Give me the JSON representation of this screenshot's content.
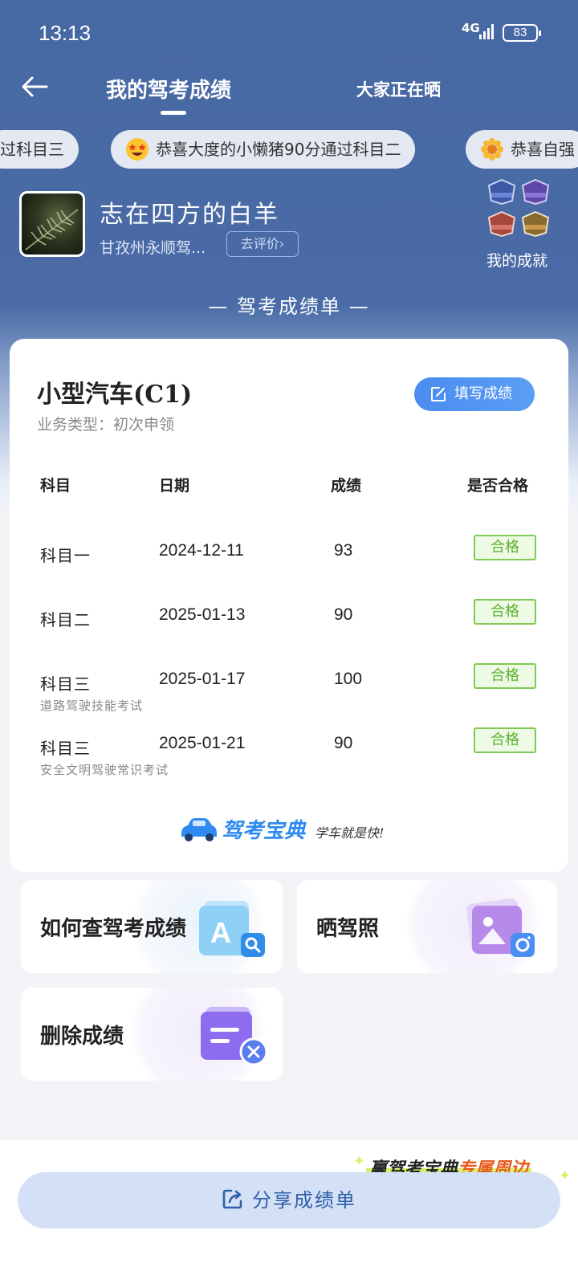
{
  "status": {
    "time": "13:13",
    "network": "4G",
    "battery": "83"
  },
  "nav": {
    "active_tab": "我的驾考成绩",
    "other_tab": "大家正在晒"
  },
  "ticker": [
    "过科目三",
    "恭喜大度的小懒猪90分通过科目二",
    "恭喜自强"
  ],
  "profile": {
    "name": "志在四方的白羊",
    "school": "甘孜州永顺驾...",
    "rate_button": "去评价",
    "achievement_label": "我的成就"
  },
  "section_title": "— 驾考成绩单 —",
  "card": {
    "car_type": "小型汽车(C1)",
    "business_type": "业务类型：初次申领",
    "fill_button": "填写成绩",
    "headers": {
      "subject": "科目",
      "date": "日期",
      "score": "成绩",
      "passed": "是否合格"
    },
    "rows": [
      {
        "subject": "科目一",
        "sub": "",
        "date": "2024-12-11",
        "score": "93",
        "status": "合格"
      },
      {
        "subject": "科目二",
        "sub": "",
        "date": "2025-01-13",
        "score": "90",
        "status": "合格"
      },
      {
        "subject": "科目三",
        "sub": "道路驾驶技能考试",
        "date": "2025-01-17",
        "score": "100",
        "status": "合格"
      },
      {
        "subject": "科目三",
        "sub": "安全文明驾驶常识考试",
        "date": "2025-01-21",
        "score": "90",
        "status": "合格"
      }
    ],
    "brand_name": "驾考宝典",
    "brand_slogan": "学车就是快!"
  },
  "tiles": {
    "query": "如何查驾考成绩",
    "show_license": "晒驾照",
    "delete": "删除成绩"
  },
  "promo": {
    "part1": "赢驾考宝典",
    "part2": "专属周边"
  },
  "share_button": "分享成绩单",
  "colors": {
    "header_blue": "#4668a3",
    "accent_blue": "#4a8cf0",
    "pass_green": "#5bb22e",
    "promo_orange": "#e8591e"
  }
}
